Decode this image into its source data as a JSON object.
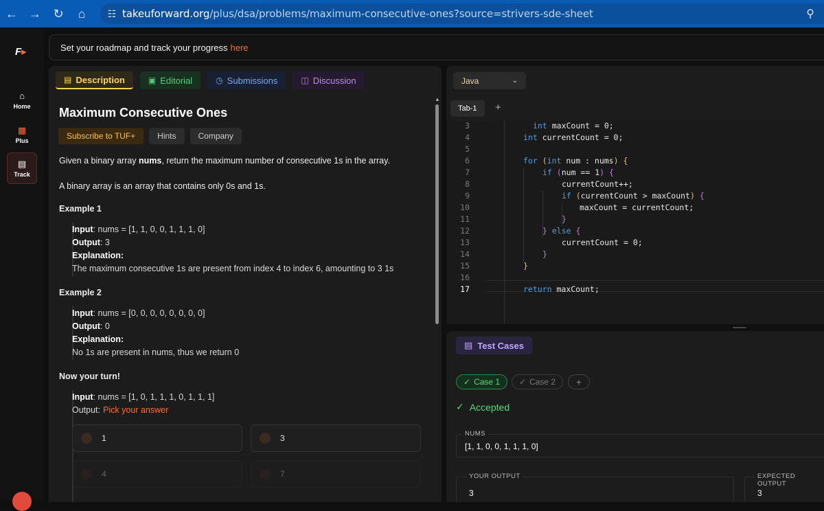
{
  "browser": {
    "url_host": "takeuforward.org",
    "url_path": "/plus/dsa/problems/maximum-consecutive-ones?source=strivers-sde-sheet"
  },
  "rail": {
    "items": [
      {
        "label": "Home",
        "icon": "home-icon"
      },
      {
        "label": "Plus",
        "icon": "plus-grid-icon"
      },
      {
        "label": "Track",
        "icon": "document-icon"
      }
    ]
  },
  "banner": {
    "text": "Set your roadmap and track your progress",
    "link": "here"
  },
  "tabs": [
    {
      "label": "Description"
    },
    {
      "label": "Editorial"
    },
    {
      "label": "Submissions"
    },
    {
      "label": "Discussion"
    }
  ],
  "problem": {
    "title": "Maximum Consecutive Ones",
    "chips": [
      "Subscribe to TUF+",
      "Hints",
      "Company"
    ],
    "statement_pre": "Given a binary array ",
    "statement_bold": "nums",
    "statement_post": ", return the maximum number of consecutive 1s in the array.",
    "note": "A binary array is an array that contains only 0s and 1s.",
    "examples": [
      {
        "title": "Example 1",
        "input_label": "Input",
        "input": ": nums = [1, 1, 0, 0, 1, 1, 1, 0]",
        "output_label": "Output",
        "output": ": 3",
        "explanation_label": "Explanation:",
        "explanation": "The maximum consecutive 1s are present from index 4 to index 6, amounting to 3 1s"
      },
      {
        "title": "Example 2",
        "input_label": "Input",
        "input": ": nums = [0, 0, 0, 0, 0, 0, 0, 0]",
        "output_label": "Output",
        "output": ": 0",
        "explanation_label": "Explanation:",
        "explanation": "No 1s are present in nums, thus we return 0"
      }
    ],
    "turn": {
      "title": "Now your turn!",
      "input_label": "Input",
      "input": ": nums = [1, 0, 1, 1, 1, 0, 1, 1, 1]",
      "output_label": "Output:",
      "pick": "Pick your answer",
      "options": [
        "1",
        "3",
        "4",
        "7"
      ]
    }
  },
  "editor": {
    "language": "Java",
    "tab": "Tab-1",
    "lines": [
      {
        "n": "3",
        "code": "int maxCount = 0;"
      },
      {
        "n": "4",
        "code": "int currentCount = 0;"
      },
      {
        "n": "5",
        "code": ""
      },
      {
        "n": "6",
        "code": "for (int num : nums) {"
      },
      {
        "n": "7",
        "code": "if (num == 1) {"
      },
      {
        "n": "8",
        "code": "currentCount++;"
      },
      {
        "n": "9",
        "code": "if (currentCount > maxCount) {"
      },
      {
        "n": "10",
        "code": "maxCount = currentCount;"
      },
      {
        "n": "11",
        "code": "}"
      },
      {
        "n": "12",
        "code": "} else {"
      },
      {
        "n": "13",
        "code": "currentCount = 0;"
      },
      {
        "n": "14",
        "code": "}"
      },
      {
        "n": "15",
        "code": "}"
      },
      {
        "n": "16",
        "code": ""
      },
      {
        "n": "17",
        "code": "return maxCount;"
      }
    ],
    "current_line": "17"
  },
  "tests": {
    "header": "Test Cases",
    "cases": [
      "Case 1",
      "Case 2"
    ],
    "status": "Accepted",
    "nums_label": "NUMS",
    "nums_value": "[1, 1, 0, 0, 1, 1, 1, 0]",
    "your_output_label": "YOUR OUTPUT",
    "your_output": "3",
    "expected_label": "EXPECTED OUTPUT",
    "expected": "3"
  },
  "colors": {
    "browser_bar": "#0a5bb5",
    "accent_orange": "#ff6a2b",
    "accepted_green": "#56d97c",
    "description_yellow": "#ffd253"
  }
}
